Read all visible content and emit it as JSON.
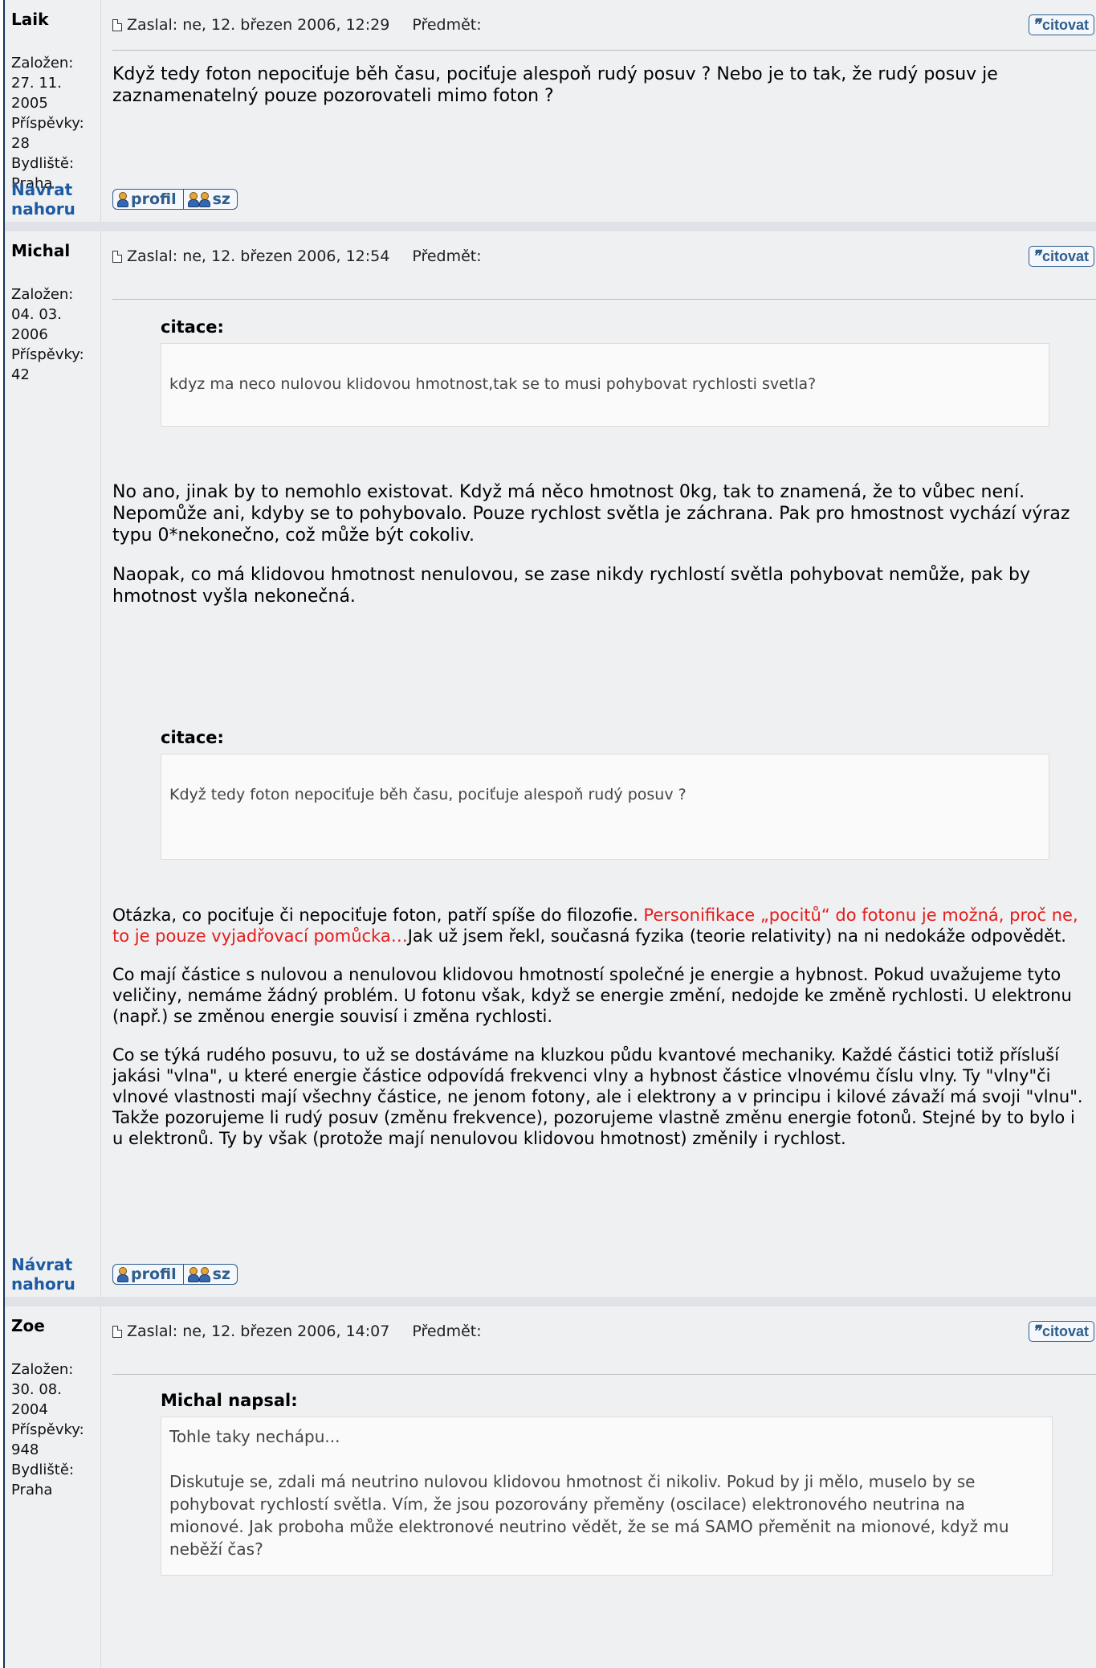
{
  "posts": [
    {
      "author": "Laik",
      "details": [
        "Založen:",
        "27. 11.",
        "2005",
        "Příspěvky:",
        "28",
        "Bydliště:",
        "Praha"
      ],
      "posted_label": "Zaslal: ne, 12. březen 2006, 12:29",
      "subject_label": "Předmět:",
      "quote_button": "citovat",
      "paragraphs": [
        "Když tedy foton nepociťuje běh času, pociťuje alespoň rudý posuv ? Nebo je to tak, že rudý posuv je zaznamenatelný pouze pozorovateli mimo foton ?"
      ]
    },
    {
      "author": "Michal",
      "details": [
        "Založen:",
        "04. 03.",
        "2006",
        "Příspěvky:",
        "42"
      ],
      "posted_label": "Zaslal: ne, 12. březen 2006, 12:54",
      "subject_label": "Předmět:",
      "quote_button": "citovat",
      "quote1_label": "citace:",
      "quote1_text": "kdyz ma neco nulovou klidovou hmotnost,tak se to musi pohybovat rychlosti svetla?",
      "para1": "No ano, jinak by to nemohlo existovat. Když má něco hmotnost 0kg, tak to znamená, že to vůbec není. Nepomůže ani, kdyby se to pohybovalo. Pouze rychlost světla je záchrana. Pak pro hmostnost vychází výraz typu 0*nekonečno, což může být cokoliv.",
      "para2": "Naopak, co má klidovou hmotnost nenulovou, se zase nikdy rychlostí světla pohybovat nemůže, pak by hmotnost vyšla nekonečná.",
      "quote2_label": "citace:",
      "quote2_text": "Když tedy foton nepociťuje běh času, pociťuje alespoň rudý posuv ?",
      "para3_start": "Otázka, co pociťuje či nepociťuje foton, patří spíše do filozofie. ",
      "para3_red": "Personifikace „pocitů“ do fotonu je možná, proč ne, to je pouze vyjadřovací pomůcka…",
      "para3_end": "Jak už jsem řekl, současná fyzika (teorie relativity) na ni nedokáže odpovědět.",
      "para4": "Co mají částice s nulovou a nenulovou klidovou hmotností společné je energie a hybnost. Pokud uvažujeme tyto veličiny, nemáme žádný problém. U fotonu však, když se energie změní, nedojde ke změně rychlosti. U elektronu (např.) se změnou energie souvisí i změna rychlosti.",
      "para5": "Co se týká rudého posuvu, to už se dostáváme na kluzkou půdu kvantové mechaniky. Každé částici totiž přísluší jakási \"vlna\", u které energie částice odpovídá frekvenci vlny a hybnost částice vlnovému číslu vlny. Ty \"vlny\"či vlnové vlastnosti mají všechny částice, ne jenom fotony, ale i elektrony a v principu i kilové závaží má svoji \"vlnu\". Takže pozorujeme li rudý posuv (změnu frekvence), pozorujeme vlastně změnu energie fotonů. Stejné by to bylo i u elektronů. Ty by však (protože mají nenulovou klidovou hmotnost) změnily i rychlost."
    },
    {
      "author": "Zoe",
      "details": [
        "Založen:",
        "30. 08.",
        "2004",
        "Příspěvky:",
        "948",
        "Bydliště:",
        "Praha"
      ],
      "posted_label": "Zaslal: ne, 12. březen 2006, 14:07",
      "subject_label": "Předmět:",
      "quote_button": "citovat",
      "quote_label": "Michal napsal:",
      "quote_para1": "Tohle taky nechápu...",
      "quote_para2": "Diskutuje se, zdali má neutrino nulovou klidovou hmotnost či nikoliv. Pokud by ji mělo, muselo by se pohybovat rychlostí světla. Vím, že jsou pozorovány přeměny (oscilace) elektronového neutrina na mionové. Jak proboha může elektronové neutrino vědět, že se má SAMO přeměnit na mionové, když mu neběží čas?"
    }
  ],
  "nav": {
    "back_to_top": "Návrat nahoru",
    "profile_button": "profil",
    "pm_button": "sz"
  }
}
